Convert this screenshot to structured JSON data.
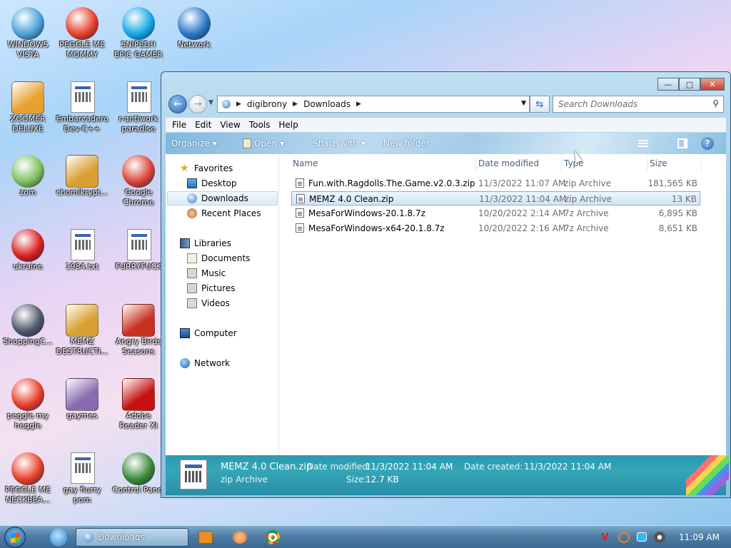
{
  "desktop": {
    "icons": [
      {
        "label": "WINDOWS VISTA",
        "icon": "vista-icon",
        "color": "#4aa0d8"
      },
      {
        "label": "PEGGLE ME MOMMY",
        "icon": "peggle-icon",
        "color": "#e8402a"
      },
      {
        "label": "SNIPED!! EPIC GAMER 360...",
        "icon": "skype-icon",
        "color": "#14a8e8"
      },
      {
        "label": "Network",
        "icon": "network-globe-icon",
        "color": "#2a78c8"
      },
      {
        "label": "ZOOMER DELUXE",
        "icon": "zuma-icon",
        "color": "#e8a030"
      },
      {
        "label": "Embarcadero Dev-C++",
        "icon": "program-file-icon",
        "color": "#3c64a8"
      },
      {
        "label": "r-antiwork paradise",
        "icon": "program-file-icon",
        "color": "#3c64a8"
      },
      {
        "label": "zom",
        "icon": "flower-icon",
        "color": "#80c060"
      },
      {
        "label": "chomikrypt...",
        "icon": "mac-app-icon",
        "color": "#d8a030"
      },
      {
        "label": "Google Chrome",
        "icon": "chrome-icon",
        "color": "#db4437"
      },
      {
        "label": "ukraine",
        "icon": "radiation-icon",
        "color": "#d82020"
      },
      {
        "label": "1984.txt",
        "icon": "text-file-icon",
        "color": "#cccccc"
      },
      {
        "label": "FURRYFUCK",
        "icon": "program-file-icon",
        "color": "#3c64a8"
      },
      {
        "label": "ShoppingC...",
        "icon": "flash-icon",
        "color": "#505a68"
      },
      {
        "label": "MEMZ DESTRUCTI...",
        "icon": "mac-app-icon",
        "color": "#d8a030"
      },
      {
        "label": "Angry Birds Seasons",
        "icon": "angry-birds-icon",
        "color": "#c83020"
      },
      {
        "label": "peggle my heggle",
        "icon": "peggle-icon",
        "color": "#e8402a"
      },
      {
        "label": "gaymes",
        "icon": "folder-icon",
        "color": "#8a6ab0"
      },
      {
        "label": "Adobe Reader XI",
        "icon": "adobe-reader-icon",
        "color": "#c81010"
      },
      {
        "label": "PEGGLE ME NECKBEA...",
        "icon": "peggle-icon",
        "color": "#e8402a"
      },
      {
        "label": "gay flurry porn",
        "icon": "program-file-icon",
        "color": "#3c64a8"
      },
      {
        "label": "Control Panel",
        "icon": "control-panel-icon",
        "color": "#3a8a3a"
      }
    ]
  },
  "window": {
    "path": [
      "digibrony",
      "Downloads"
    ],
    "search_placeholder": "Search Downloads",
    "menu": [
      "File",
      "Edit",
      "View",
      "Tools",
      "Help"
    ],
    "commands": {
      "organize": "Organize",
      "open": "Open",
      "share": "Share with",
      "new_folder": "New folder"
    },
    "nav": {
      "favorites": "Favorites",
      "favorites_items": [
        "Desktop",
        "Downloads",
        "Recent Places"
      ],
      "libraries": "Libraries",
      "libraries_items": [
        "Documents",
        "Music",
        "Pictures",
        "Videos"
      ],
      "computer": "Computer",
      "network": "Network"
    },
    "columns": {
      "name": "Name",
      "date": "Date modified",
      "type": "Type",
      "size": "Size"
    },
    "files": [
      {
        "name": "Fun.with.Ragdolls.The.Game.v2.0.3.zip",
        "date": "11/3/2022 11:07 AM",
        "type": "zip Archive",
        "size": "181,565 KB"
      },
      {
        "name": "MEMZ 4.0 Clean.zip",
        "date": "11/3/2022 11:04 AM",
        "type": "zip Archive",
        "size": "13 KB"
      },
      {
        "name": "MesaForWindows-20.1.8.7z",
        "date": "10/20/2022 2:14 AM",
        "type": "7z Archive",
        "size": "6,895 KB"
      },
      {
        "name": "MesaForWindows-x64-20.1.8.7z",
        "date": "10/20/2022 2:16 AM",
        "type": "7z Archive",
        "size": "8,651 KB"
      }
    ],
    "selected_index": 1,
    "details": {
      "name": "MEMZ 4.0 Clean.zip",
      "type": "zip Archive",
      "modified_label": "Date modified:",
      "modified": "11/3/2022 11:04 AM",
      "created_label": "Date created:",
      "created": "11/3/2022 11:04 AM",
      "size_label": "Size:",
      "size": "12.7 KB"
    }
  },
  "taskbar": {
    "task_label": "Downloads",
    "clock": "11:09 AM"
  }
}
